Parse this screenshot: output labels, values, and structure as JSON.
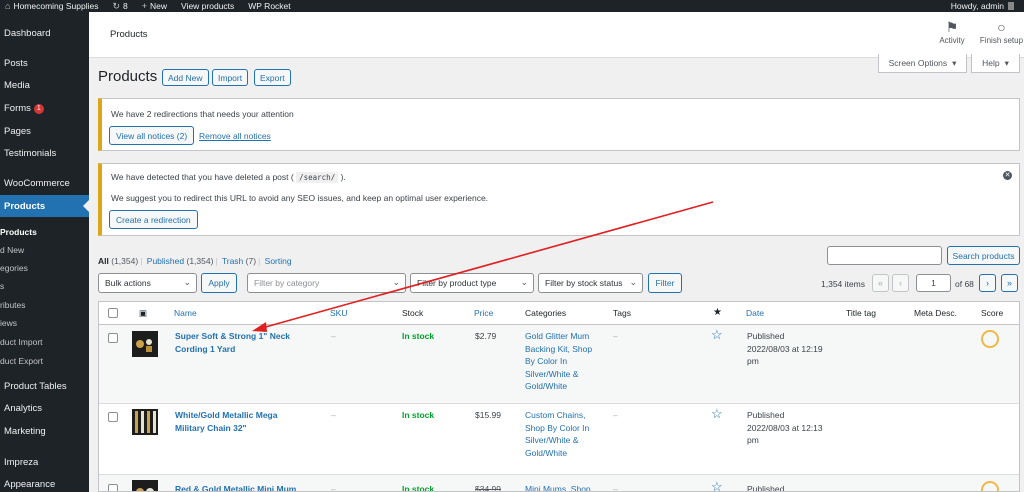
{
  "admin_bar": {
    "site_name": "Homecoming Supplies",
    "updates_count": "8",
    "new_label": "New",
    "view_products": "View products",
    "wp_rocket": "WP Rocket",
    "howdy": "Howdy, admin"
  },
  "sidebar": {
    "items": [
      {
        "label": "Dashboard"
      },
      {
        "label": "Posts"
      },
      {
        "label": "Media"
      },
      {
        "label": "Forms",
        "badge": "1"
      },
      {
        "label": "Pages"
      },
      {
        "label": "Testimonials"
      },
      {
        "label": "WooCommerce"
      },
      {
        "label": "Products"
      },
      {
        "label": "Product Tables"
      },
      {
        "label": "Analytics"
      },
      {
        "label": "Marketing"
      },
      {
        "label": "Impreza"
      },
      {
        "label": "Appearance"
      }
    ],
    "submenu": [
      "Products",
      "d New",
      "egories",
      "s",
      "ributes",
      "iews",
      "duct Import",
      "duct Export"
    ]
  },
  "topbar": {
    "breadcrumb": "Products",
    "activity": "Activity",
    "finish_setup": "Finish setup"
  },
  "screen_options": "Screen Options",
  "help": "Help",
  "page": {
    "title": "Products",
    "add_new": "Add New",
    "import": "Import",
    "export": "Export"
  },
  "notice1": {
    "text": "We have 2 redirections that needs your attention",
    "view_all": "View all notices (2)",
    "remove_all": "Remove all notices"
  },
  "notice2": {
    "text_before": "We have detected that you have deleted a post (",
    "path": "/search/",
    "text_after": ").",
    "suggestion": "We suggest you to redirect this URL to avoid any SEO issues, and keep an optimal user experience.",
    "button": "Create a redirection"
  },
  "views": {
    "all": "All",
    "all_count": "(1,354)",
    "published": "Published",
    "published_count": "(1,354)",
    "trash": "Trash",
    "trash_count": "(7)",
    "sorting": "Sorting"
  },
  "search": {
    "button": "Search products",
    "placeholder": ""
  },
  "filters": {
    "bulk_actions": "Bulk actions",
    "apply": "Apply",
    "category_placeholder": "Filter by category",
    "product_type": "Filter by product type",
    "stock_status": "Filter by stock status",
    "filter": "Filter"
  },
  "pagination": {
    "items": "1,354 items",
    "first": "«",
    "prev": "‹",
    "current_page": "1",
    "of": "of 68",
    "next": "›",
    "last": "»"
  },
  "table": {
    "columns": {
      "name": "Name",
      "sku": "SKU",
      "stock": "Stock",
      "price": "Price",
      "categories": "Categories",
      "tags": "Tags",
      "date": "Date",
      "title_tag": "Title tag",
      "meta_desc": "Meta Desc.",
      "score": "Score"
    },
    "rows": [
      {
        "name_line1": "Super Soft & Strong 1\" Neck",
        "name_line2": "Cording 1 Yard",
        "sku": "–",
        "stock": "In stock",
        "price": "$2.79",
        "categories": [
          "Gold Glitter Mum",
          "Backing Kit, Shop",
          "By Color In",
          "Silver/White &",
          "Gold/White"
        ],
        "tags": "–",
        "date_status": "Published",
        "date_line1": "2022/08/03 at 12:19",
        "date_line2": "pm"
      },
      {
        "name_line1": "White/Gold Metallic Mega",
        "name_line2": "Military Chain 32\"",
        "sku": "–",
        "stock": "In stock",
        "price": "$15.99",
        "categories": [
          "Custom Chains,",
          "Shop By Color In",
          "Silver/White &",
          "Gold/White"
        ],
        "tags": "–",
        "date_status": "Published",
        "date_line1": "2022/08/03 at 12:13",
        "date_line2": "pm"
      },
      {
        "name_line1": "Red & Gold Metallic Mini Mum",
        "sku": "–",
        "stock": "In stock",
        "price_old": "$34.99",
        "categories": [
          "Mini Mums, Shop"
        ],
        "tags": "–",
        "date_status": "Published"
      }
    ]
  },
  "annotation": {
    "arrow_color": "#e02020"
  },
  "colors": {
    "accent": "#2271b1",
    "sidebar_bg": "#1d2327",
    "instock": "#00a32a",
    "notice_border": "#dba617"
  }
}
